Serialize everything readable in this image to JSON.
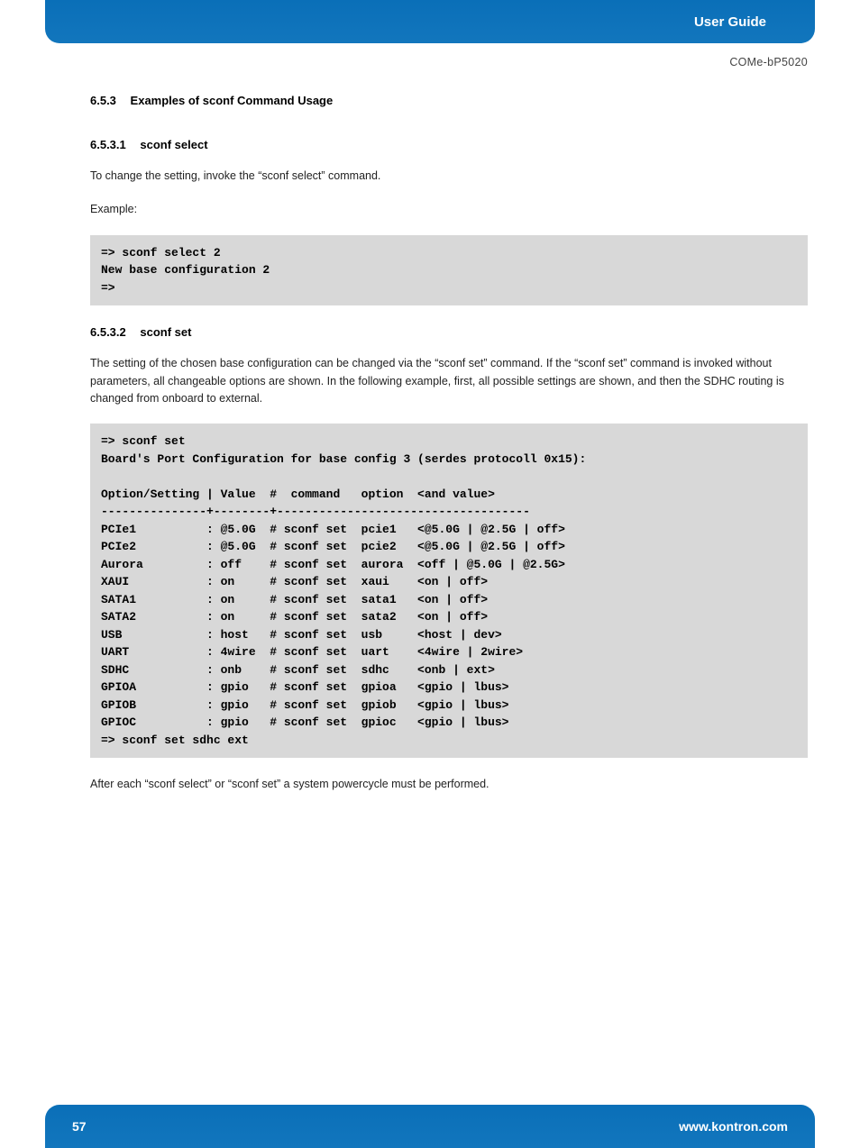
{
  "header": {
    "title": "User Guide",
    "doc_id": "COMe-bP5020"
  },
  "section_653": {
    "number": "6.5.3",
    "title": "Examples of sconf Command Usage"
  },
  "section_6531": {
    "number": "6.5.3.1",
    "title": "sconf select",
    "para1": "To change the setting, invoke the “sconf select” command.",
    "para2": "Example:",
    "code": "=> sconf select 2\nNew base configuration 2\n=>"
  },
  "section_6532": {
    "number": "6.5.3.2",
    "title": "sconf set",
    "para1": "The setting of the chosen base configuration can be changed via the “sconf set” command. If the “sconf set” command is invoked without parameters, all changeable options are shown. In the following example, first, all possible settings are shown, and then the SDHC routing is changed from onboard to external.",
    "code": "=> sconf set\nBoard's Port Configuration for base config 3 (serdes protocoll 0x15):\n\nOption/Setting | Value  #  command   option  <and value>\n---------------+--------+------------------------------------\nPCIe1          : @5.0G  # sconf set  pcie1   <@5.0G | @2.5G | off>\nPCIe2          : @5.0G  # sconf set  pcie2   <@5.0G | @2.5G | off>\nAurora         : off    # sconf set  aurora  <off | @5.0G | @2.5G>\nXAUI           : on     # sconf set  xaui    <on | off>\nSATA1          : on     # sconf set  sata1   <on | off>\nSATA2          : on     # sconf set  sata2   <on | off>\nUSB            : host   # sconf set  usb     <host | dev>\nUART           : 4wire  # sconf set  uart    <4wire | 2wire>\nSDHC           : onb    # sconf set  sdhc    <onb | ext>\nGPIOA          : gpio   # sconf set  gpioa   <gpio | lbus>\nGPIOB          : gpio   # sconf set  gpiob   <gpio | lbus>\nGPIOC          : gpio   # sconf set  gpioc   <gpio | lbus>\n=> sconf set sdhc ext",
    "para2": "After each “sconf select” or “sconf set” a system powercycle must be performed."
  },
  "footer": {
    "page": "57",
    "url": "www.kontron.com"
  }
}
